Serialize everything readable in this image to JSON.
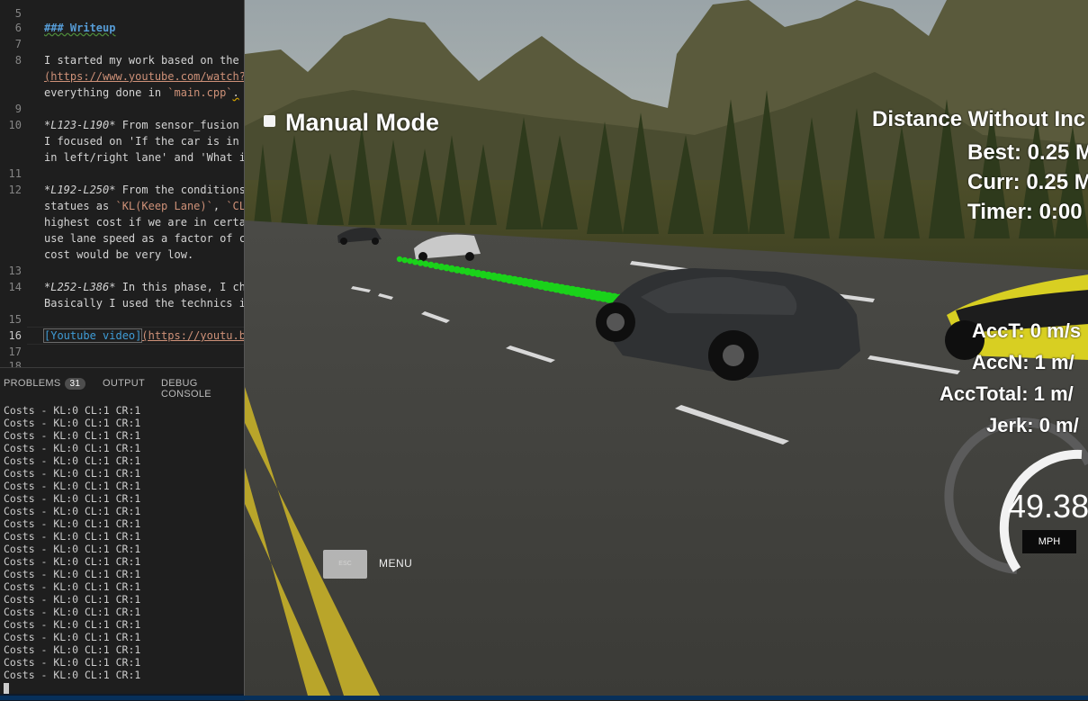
{
  "editor": {
    "lines": [
      {
        "num": "5",
        "text": ""
      },
      {
        "num": "6",
        "text": "### Writeup"
      },
      {
        "num": "7",
        "text": ""
      },
      {
        "num": "8",
        "text": "I started my work based on the"
      },
      {
        "num": "",
        "text": "(https://www.youtube.com/watch?"
      },
      {
        "num": "",
        "text": "everything done in `main.cpp`."
      },
      {
        "num": "9",
        "text": ""
      },
      {
        "num": "10",
        "text": "*L123-L190* From sensor_fusion"
      },
      {
        "num": "",
        "text": "I focused on 'If the car is in"
      },
      {
        "num": "",
        "text": "in left/right lane' and 'What i"
      },
      {
        "num": "11",
        "text": ""
      },
      {
        "num": "12",
        "text": "*L192-L250* From the conditions"
      },
      {
        "num": "",
        "text": "statues as `KL(Keep Lane)`, `CL"
      },
      {
        "num": "",
        "text": "highest cost if we are in certa"
      },
      {
        "num": "",
        "text": "use lane speed as a factor of c"
      },
      {
        "num": "",
        "text": "cost would be very low."
      },
      {
        "num": "13",
        "text": ""
      },
      {
        "num": "14",
        "text": "*L252-L386* In this phase, I ch"
      },
      {
        "num": "",
        "text": "Basically I used the technics i"
      },
      {
        "num": "15",
        "text": ""
      },
      {
        "num": "16",
        "text": "[Youtube video](https://youtu.b"
      },
      {
        "num": "17",
        "text": ""
      },
      {
        "num": "18",
        "text": ""
      }
    ],
    "heading": "### Writeup",
    "l8a": "I started my work based on the",
    "l8b": "(https://www.youtube.com/watch?",
    "l8c_pre": "everything done in ",
    "l8c_code": "`main.cpp`",
    "l8c_post": ".",
    "l10_range": "*L123-L190*",
    "l10a": " From sensor_fusion",
    "l10b": "I focused on 'If the car is in",
    "l10c": "in left/right lane' and 'What i",
    "l12_range": "*L192-L250*",
    "l12a": " From the conditions",
    "l12b_pre": "statues as ",
    "l12b_code1": "`KL(Keep Lane)`",
    "l12b_mid": ", ",
    "l12b_code2": "`CL",
    "l12c": "highest cost if we are in certa",
    "l12d": "use lane speed as a factor of c",
    "l12e": "cost would be very low.",
    "l14_range": "*L252-L386*",
    "l14a": " In this phase, I ch",
    "l14b": "Basically I used the technics i",
    "l16_label": "[Youtube video]",
    "l16_link": "(https://youtu.b"
  },
  "panel": {
    "problems_label": "PROBLEMS",
    "problems_count": "31",
    "output_label": "OUTPUT",
    "debug_label": "DEBUG CONSOLE",
    "terminal_lines": [
      "Costs - KL:0 CL:1 CR:1",
      "Costs - KL:0 CL:1 CR:1",
      "Costs - KL:0 CL:1 CR:1",
      "Costs - KL:0 CL:1 CR:1",
      "Costs - KL:0 CL:1 CR:1",
      "Costs - KL:0 CL:1 CR:1",
      "Costs - KL:0 CL:1 CR:1",
      "Costs - KL:0 CL:1 CR:1",
      "Costs - KL:0 CL:1 CR:1",
      "Costs - KL:0 CL:1 CR:1",
      "Costs - KL:0 CL:1 CR:1",
      "Costs - KL:0 CL:1 CR:1",
      "Costs - KL:0 CL:1 CR:1",
      "Costs - KL:0 CL:1 CR:1",
      "Costs - KL:0 CL:1 CR:1",
      "Costs - KL:0 CL:1 CR:1",
      "Costs - KL:0 CL:1 CR:1",
      "Costs - KL:0 CL:1 CR:1",
      "Costs - KL:0 CL:1 CR:1",
      "Costs - KL:0 CL:1 CR:1",
      "Costs - KL:0 CL:1 CR:1",
      "Costs - KL:0 CL:1 CR:1"
    ]
  },
  "simulator": {
    "manual_mode": "Manual Mode",
    "distance_title": "Distance Without Inc",
    "best": "Best: 0.25 M",
    "curr": "Curr: 0.25 M",
    "timer": "Timer: 0:00",
    "acc_t": "AccT: 0 m/s",
    "acc_n": "AccN: 1 m/",
    "acc_total": "AccTotal: 1 m/",
    "jerk": "Jerk: 0 m/",
    "speed": "49.38",
    "speed_unit": "MPH",
    "esc_key": "ESC",
    "menu": "MENU",
    "speed_gauge_fraction": 0.7
  }
}
